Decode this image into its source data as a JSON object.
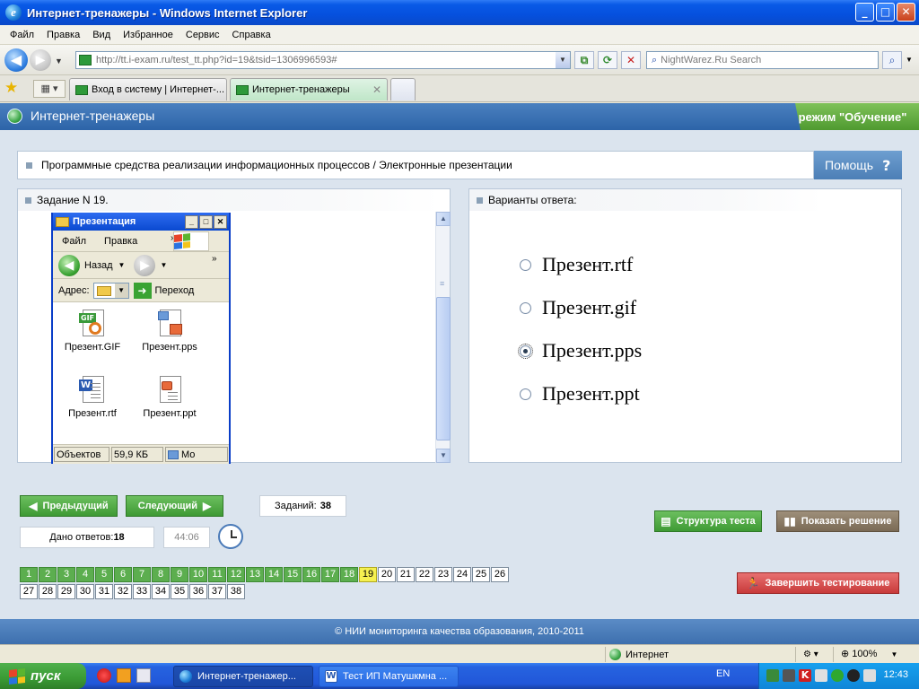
{
  "window": {
    "title": "Интернет-тренажеры - Windows Internet Explorer",
    "controls": {
      "minimize": "_",
      "maximize": "□",
      "close": "✕"
    }
  },
  "menu": [
    "Файл",
    "Правка",
    "Вид",
    "Избранное",
    "Сервис",
    "Справка"
  ],
  "address_bar": {
    "url": "http://tt.i-exam.ru/test_tt.php?id=19&tsid=1306996593#"
  },
  "search": {
    "placeholder": "NightWarez.Ru Search"
  },
  "tabs": [
    {
      "label": "Вход в систему | Интернет-...",
      "active": false
    },
    {
      "label": "Интернет-тренажеры",
      "active": true
    }
  ],
  "app": {
    "title": "Интернет-тренажеры",
    "mode": "режим \"Обучение\"",
    "topic": "Программные средства реализации информационных процессов / Электронные презентации",
    "help_label": "Помощь",
    "help_icon": "?"
  },
  "task": {
    "heading": "Задание N 19.",
    "explorer": {
      "title": "Презентация",
      "menu": [
        "Файл",
        "Правка"
      ],
      "back_label": "Назад",
      "address_label": "Адрес:",
      "go_label": "Переход",
      "files": [
        {
          "name": "Презент.GIF",
          "icon": "gif-file-icon",
          "tag": "GIF"
        },
        {
          "name": "Презент.pps",
          "icon": "pps-file-icon",
          "tag": ""
        },
        {
          "name": "Презент.rtf",
          "icon": "rtf-file-icon",
          "tag": "W"
        },
        {
          "name": "Презент.ppt",
          "icon": "ppt-file-icon",
          "tag": ""
        }
      ],
      "status": [
        "Объектов",
        "59,9 КБ",
        "Мо"
      ]
    }
  },
  "answers": {
    "heading": "Варианты ответа:",
    "options": [
      {
        "label": "Презент.rtf",
        "checked": false
      },
      {
        "label": "Презент.gif",
        "checked": false
      },
      {
        "label": "Презент.pps",
        "checked": true
      },
      {
        "label": "Презент.ppt",
        "checked": false
      }
    ]
  },
  "nav": {
    "prev_label": "Предыдущий",
    "next_label": "Следующий",
    "tasks_label": "Заданий:",
    "tasks_count": "38",
    "answered_label": "Дано ответов:",
    "answered_count": "18",
    "timer": "44:06",
    "structure_label": "Структура теста",
    "solution_label": "Показать решение",
    "finish_label": "Завершить тестирование"
  },
  "questions": {
    "total": 38,
    "answered": [
      1,
      2,
      3,
      4,
      5,
      6,
      7,
      8,
      9,
      10,
      11,
      12,
      13,
      14,
      15,
      16,
      17,
      18
    ],
    "current": 19
  },
  "footer": "© НИИ мониторинга качества образования, 2010-2011",
  "ie_status": {
    "zone": "Интернет",
    "zoom": "100%"
  },
  "taskbar": {
    "start_label": "пуск",
    "tasks": [
      "Интернет-тренажер...",
      "Тест ИП Матушкмна ..."
    ],
    "lang": "EN",
    "time": "12:43"
  },
  "colors": {
    "xp_blue": "#0a49c8",
    "header_blue": "#3a6fb0",
    "mode_green": "#5aa83a",
    "done_green": "#5cae4f",
    "current_yellow": "#f5f050",
    "finish_red": "#d04848"
  }
}
